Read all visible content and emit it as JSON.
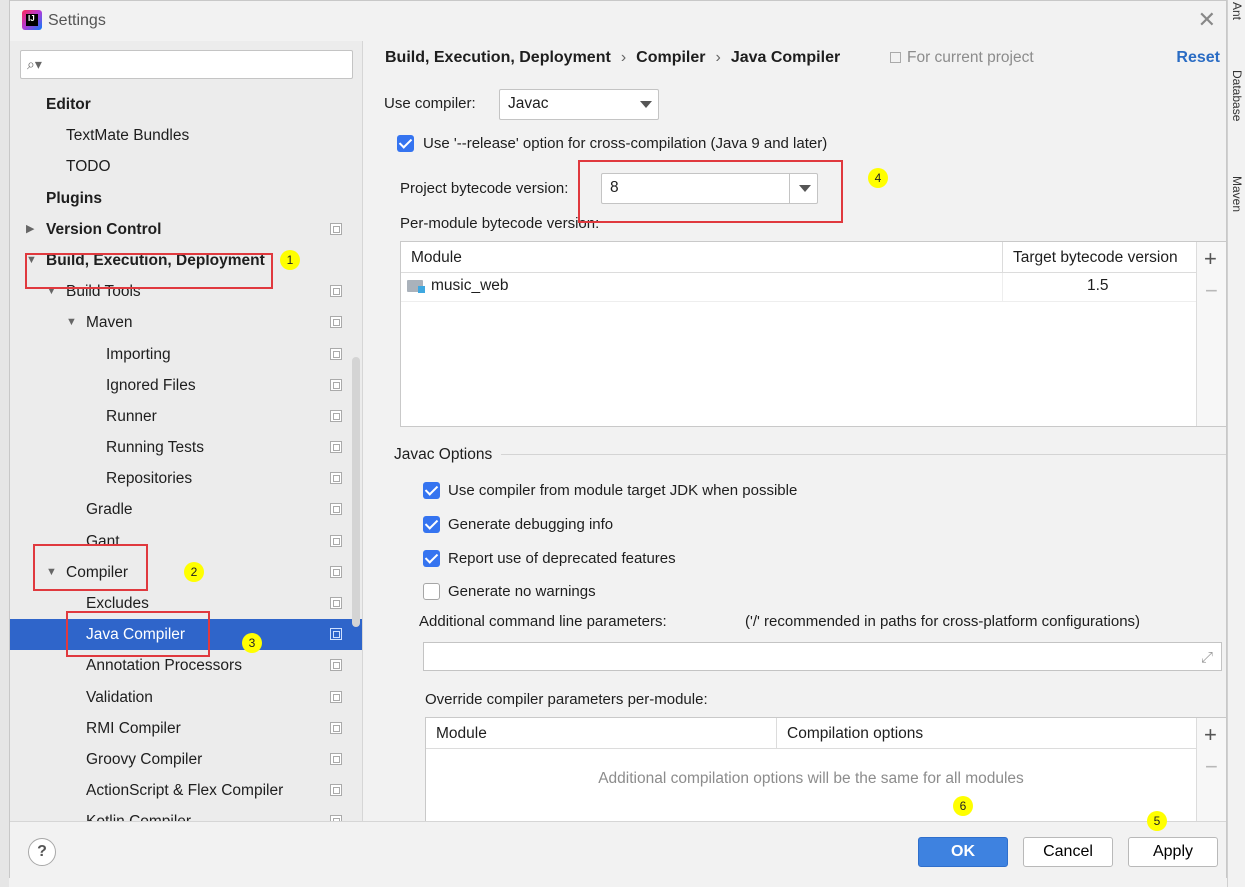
{
  "window": {
    "title": "Settings"
  },
  "sidebar": {
    "search_placeholder": "",
    "items": [
      {
        "label": "Editor",
        "indent": 0,
        "bold": true,
        "arrow": "",
        "proj": false
      },
      {
        "label": "TextMate Bundles",
        "indent": 1,
        "bold": false,
        "arrow": "",
        "proj": false
      },
      {
        "label": "TODO",
        "indent": 1,
        "bold": false,
        "arrow": "",
        "proj": false
      },
      {
        "label": "Plugins",
        "indent": 0,
        "bold": true,
        "arrow": "",
        "proj": false
      },
      {
        "label": "Version Control",
        "indent": 0,
        "bold": true,
        "arrow": "right",
        "proj": true
      },
      {
        "label": "Build, Execution, Deployment",
        "indent": 0,
        "bold": true,
        "arrow": "down",
        "proj": false
      },
      {
        "label": "Build Tools",
        "indent": 1,
        "bold": false,
        "arrow": "down",
        "proj": true
      },
      {
        "label": "Maven",
        "indent": 2,
        "bold": false,
        "arrow": "down",
        "proj": true
      },
      {
        "label": "Importing",
        "indent": 3,
        "bold": false,
        "arrow": "",
        "proj": true
      },
      {
        "label": "Ignored Files",
        "indent": 3,
        "bold": false,
        "arrow": "",
        "proj": true
      },
      {
        "label": "Runner",
        "indent": 3,
        "bold": false,
        "arrow": "",
        "proj": true
      },
      {
        "label": "Running Tests",
        "indent": 3,
        "bold": false,
        "arrow": "",
        "proj": true
      },
      {
        "label": "Repositories",
        "indent": 3,
        "bold": false,
        "arrow": "",
        "proj": true
      },
      {
        "label": "Gradle",
        "indent": 2,
        "bold": false,
        "arrow": "",
        "proj": true
      },
      {
        "label": "Gant",
        "indent": 2,
        "bold": false,
        "arrow": "",
        "proj": true
      },
      {
        "label": "Compiler",
        "indent": 1,
        "bold": false,
        "arrow": "down",
        "proj": true
      },
      {
        "label": "Excludes",
        "indent": 2,
        "bold": false,
        "arrow": "",
        "proj": true
      },
      {
        "label": "Java Compiler",
        "indent": 2,
        "bold": false,
        "arrow": "",
        "proj": true,
        "selected": true
      },
      {
        "label": "Annotation Processors",
        "indent": 2,
        "bold": false,
        "arrow": "",
        "proj": true
      },
      {
        "label": "Validation",
        "indent": 2,
        "bold": false,
        "arrow": "",
        "proj": true
      },
      {
        "label": "RMI Compiler",
        "indent": 2,
        "bold": false,
        "arrow": "",
        "proj": true
      },
      {
        "label": "Groovy Compiler",
        "indent": 2,
        "bold": false,
        "arrow": "",
        "proj": true
      },
      {
        "label": "ActionScript & Flex Compiler",
        "indent": 2,
        "bold": false,
        "arrow": "",
        "proj": true
      },
      {
        "label": "Kotlin Compiler",
        "indent": 2,
        "bold": false,
        "arrow": "",
        "proj": true
      }
    ]
  },
  "header": {
    "crumbs": [
      "Build, Execution, Deployment",
      "Compiler",
      "Java Compiler"
    ],
    "for_project": "For current project",
    "reset": "Reset"
  },
  "compiler": {
    "use_label": "Use compiler:",
    "use_value": "Javac",
    "release_label": "Use '--release' option for cross-compilation (Java 9 and later)",
    "bytecode_label": "Project bytecode version:",
    "bytecode_value": "8",
    "per_module_label": "Per-module bytecode version:",
    "table": {
      "col_module": "Module",
      "col_target": "Target bytecode version",
      "rows": [
        {
          "module": "music_web",
          "target": "1.5"
        }
      ]
    }
  },
  "javac": {
    "title": "Javac Options",
    "options": [
      {
        "label": "Use compiler from module target JDK when possible",
        "checked": true
      },
      {
        "label": "Generate debugging info",
        "checked": true
      },
      {
        "label": "Report use of deprecated features",
        "checked": true
      },
      {
        "label": "Generate no warnings",
        "checked": false
      }
    ],
    "additional_label": "Additional command line parameters:",
    "additional_hint": "('/' recommended in paths for cross-platform configurations)",
    "additional_value": "",
    "override_label": "Override compiler parameters per-module:",
    "override_table": {
      "col_module": "Module",
      "col_options": "Compilation options",
      "empty_text": "Additional compilation options will be the same for all modules"
    }
  },
  "buttons": {
    "help": "?",
    "ok": "OK",
    "cancel": "Cancel",
    "apply": "Apply"
  },
  "markers": [
    "1",
    "2",
    "3",
    "4",
    "5",
    "6"
  ],
  "side_panels": [
    "Ant",
    "Database",
    "Maven"
  ],
  "colors": {
    "selection": "#2f65ca",
    "accent": "#3574f0",
    "annotation_red": "#e0393e",
    "marker_yellow": "#ffff00"
  }
}
